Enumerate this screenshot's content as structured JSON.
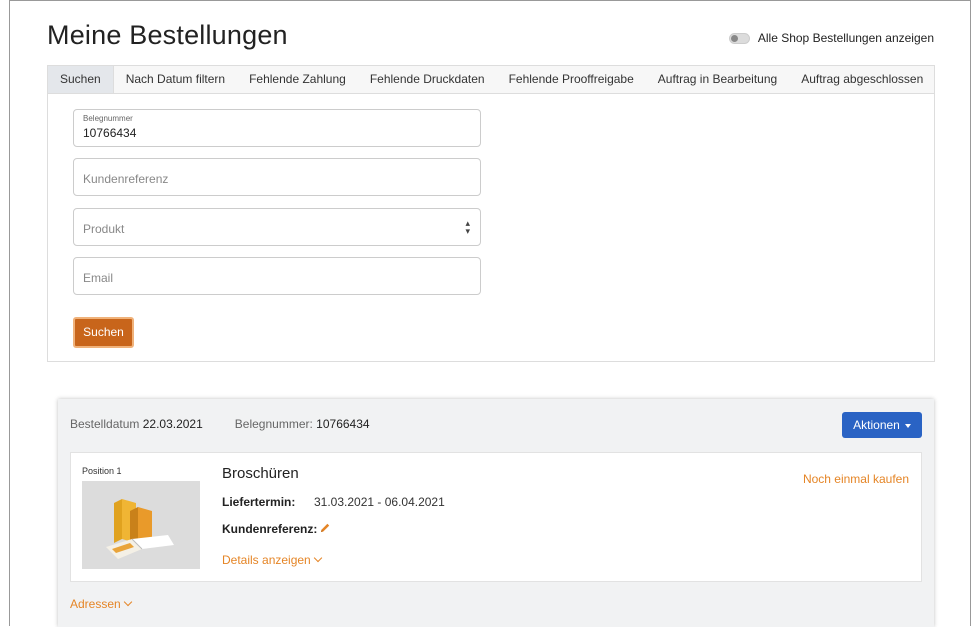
{
  "page_title": "Meine Bestellungen",
  "toggle_label": "Alle Shop Bestellungen anzeigen",
  "tabs": [
    {
      "label": "Suchen"
    },
    {
      "label": "Nach Datum filtern"
    },
    {
      "label": "Fehlende Zahlung"
    },
    {
      "label": "Fehlende Druckdaten"
    },
    {
      "label": "Fehlende Prooffreigabe"
    },
    {
      "label": "Auftrag in Bearbeitung"
    },
    {
      "label": "Auftrag abgeschlossen"
    }
  ],
  "form": {
    "belegnummer_label": "Belegnummer",
    "belegnummer_value": "10766434",
    "kundenreferenz_placeholder": "Kundenreferenz",
    "produkt_placeholder": "Produkt",
    "email_placeholder": "Email",
    "search_button": "Suchen"
  },
  "order": {
    "date_label": "Bestelldatum",
    "date_value": "22.03.2021",
    "number_label": "Belegnummer:",
    "number_value": "10766434",
    "actions_button": "Aktionen",
    "position_label": "Position 1",
    "product_name": "Broschüren",
    "liefertermin_label": "Liefertermin:",
    "liefertermin_value": "31.03.2021 - 06.04.2021",
    "kundenreferenz_label": "Kundenreferenz:",
    "details_link": "Details anzeigen",
    "buy_again_link": "Noch einmal kaufen",
    "addresses_link": "Adressen"
  },
  "colors": {
    "accent_orange": "#e58526",
    "button_orange": "#c8651b",
    "button_blue": "#2a63c4"
  },
  "icons": {
    "edit": "pencil-icon",
    "toggle": "toggle-switch",
    "select": "sort-arrows-icon",
    "chevron": "chevron-down-icon"
  }
}
